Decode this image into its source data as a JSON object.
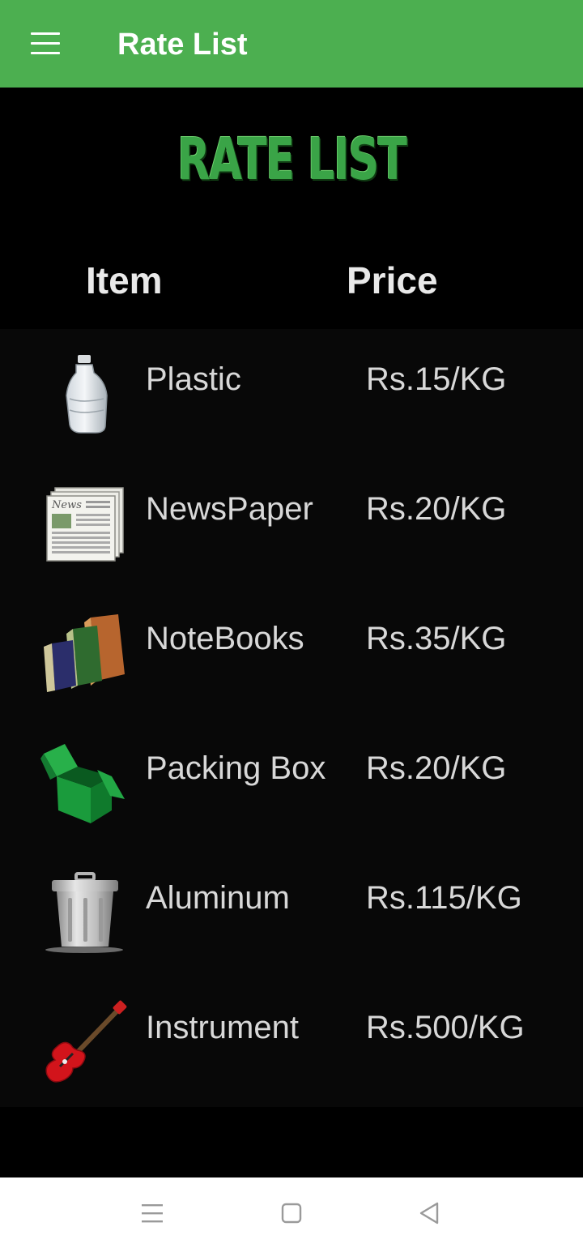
{
  "appbar": {
    "title": "Rate List",
    "menu_icon": "hamburger-menu-icon"
  },
  "banner": {
    "text": "RATE LIST"
  },
  "columns": {
    "item": "Item",
    "price": "Price"
  },
  "items": [
    {
      "name": "Plastic",
      "price": "Rs.15/KG",
      "icon": "plastic-bottle-icon"
    },
    {
      "name": "NewsPaper",
      "price": "Rs.20/KG",
      "icon": "newspaper-icon"
    },
    {
      "name": "NoteBooks",
      "price": "Rs.35/KG",
      "icon": "notebooks-icon"
    },
    {
      "name": "Packing Box",
      "price": "Rs.20/KG",
      "icon": "packing-box-icon"
    },
    {
      "name": "Aluminum",
      "price": "Rs.115/KG",
      "icon": "trash-can-icon"
    },
    {
      "name": "Instrument",
      "price": "Rs.500/KG",
      "icon": "guitar-icon"
    }
  ],
  "navbar": {
    "menu_icon": "recent-apps-icon",
    "home_icon": "home-icon",
    "back_icon": "back-icon"
  },
  "colors": {
    "appbar": "#4caf50",
    "banner_text": "#3aa447",
    "background": "#000000",
    "list_background": "#080808"
  }
}
